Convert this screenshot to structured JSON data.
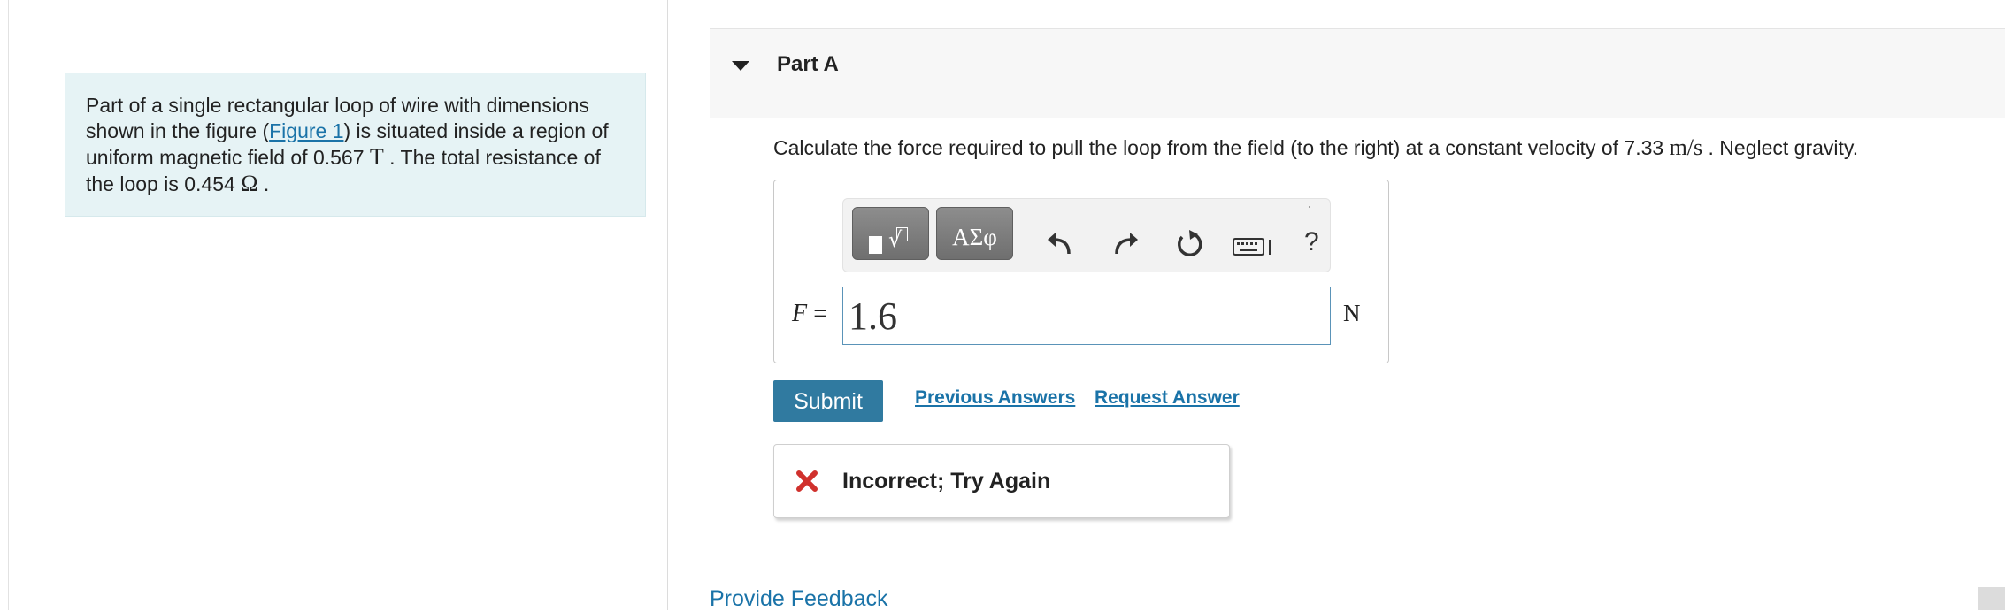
{
  "problem": {
    "text_before_link": "Part of a single rectangular loop of wire with dimensions shown in the figure (",
    "figure_link": "Figure 1",
    "text_after_link": ") is situated inside a region of uniform magnetic field of 0.567 ",
    "field_unit": "T",
    "text_resistance": " . The total resistance of the loop is 0.454 ",
    "resistance_unit": "Ω",
    "text_end": " ."
  },
  "part": {
    "title": "Part A",
    "question_before": "Calculate the force required to pull the loop from the field (to the right) at a constant velocity of 7.33 ",
    "velocity_unit": "m/s",
    "question_after": " . Neglect gravity."
  },
  "toolbar": {
    "greek_label": "ΑΣφ",
    "help_label": "?"
  },
  "answer": {
    "variable": "F",
    "equals": " =",
    "value": "1.6",
    "unit": "N"
  },
  "actions": {
    "submit_label": "Submit",
    "previous_answers_label": "Previous Answers",
    "request_answer_label": "Request Answer"
  },
  "feedback": {
    "status_text": "Incorrect; Try Again",
    "status_color": "#d0312d"
  },
  "footer": {
    "provide_feedback_label": "Provide Feedback"
  },
  "colors": {
    "accent": "#307aa0",
    "link": "#1a73a8",
    "info_bg": "#e6f3f5"
  }
}
